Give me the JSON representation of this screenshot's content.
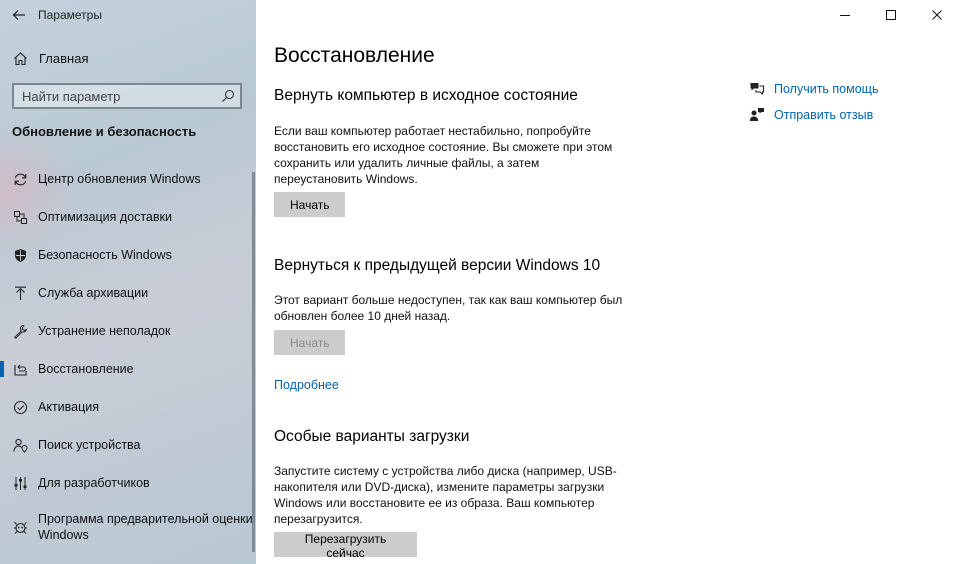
{
  "window": {
    "title": "Параметры"
  },
  "sidebar": {
    "home_label": "Главная",
    "search_placeholder": "Найти параметр",
    "section_title": "Обновление и безопасность",
    "items": [
      {
        "label": "Центр обновления Windows",
        "icon": "sync-icon"
      },
      {
        "label": "Оптимизация доставки",
        "icon": "delivery-optimization-icon"
      },
      {
        "label": "Безопасность Windows",
        "icon": "shield-icon"
      },
      {
        "label": "Служба архивации",
        "icon": "backup-arrow-icon"
      },
      {
        "label": "Устранение неполадок",
        "icon": "wrench-icon"
      },
      {
        "label": "Восстановление",
        "icon": "recovery-icon",
        "active": true
      },
      {
        "label": "Активация",
        "icon": "check-circle-icon"
      },
      {
        "label": "Поиск устройства",
        "icon": "person-location-icon"
      },
      {
        "label": "Для разработчиков",
        "icon": "developer-sliders-icon"
      },
      {
        "label": "Программа предварительной оценки Windows",
        "icon": "insider-icon"
      }
    ]
  },
  "main": {
    "title": "Восстановление",
    "reset": {
      "heading": "Вернуть компьютер в исходное состояние",
      "text": "Если ваш компьютер работает нестабильно, попробуйте восстановить его исходное состояние. Вы сможете при этом сохранить или удалить личные файлы, а затем переустановить Windows.",
      "button": "Начать"
    },
    "rollback": {
      "heading": "Вернуться к предыдущей версии Windows 10",
      "text": "Этот вариант больше недоступен, так как ваш компьютер был обновлен более 10 дней назад.",
      "button": "Начать",
      "link": "Подробнее"
    },
    "advanced": {
      "heading": "Особые варианты загрузки",
      "text": "Запустите систему с устройства либо диска (например, USB-накопителя или DVD-диска), измените параметры загрузки Windows или восстановите ее из образа. Ваш компьютер перезагрузится.",
      "button": "Перезагрузить сейчас"
    }
  },
  "help": {
    "get_help": "Получить помощь",
    "feedback": "Отправить отзыв"
  },
  "colors": {
    "accent": "#0063b1",
    "button_bg": "#cccccc"
  }
}
